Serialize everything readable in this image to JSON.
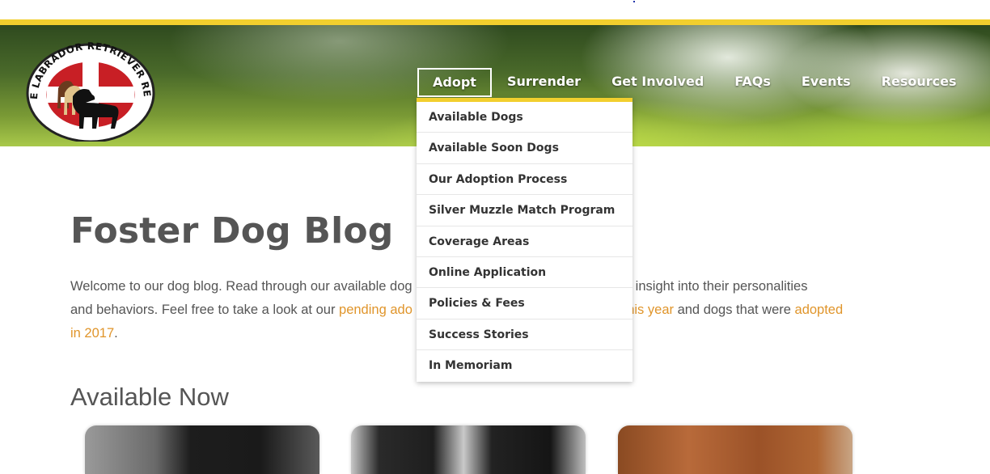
{
  "logo": {
    "text": "BROOKLINE LABRADOR RETRIEVER RESCUE, INC."
  },
  "nav": {
    "items": [
      {
        "label": "Adopt"
      },
      {
        "label": "Surrender"
      },
      {
        "label": "Get Involved"
      },
      {
        "label": "FAQs"
      },
      {
        "label": "Events"
      },
      {
        "label": "Resources"
      }
    ]
  },
  "adopt_menu": {
    "items": [
      {
        "label": "Available Dogs"
      },
      {
        "label": "Available Soon Dogs"
      },
      {
        "label": "Our Adoption Process"
      },
      {
        "label": "Silver Muzzle Match Program"
      },
      {
        "label": "Coverage Areas"
      },
      {
        "label": "Online Application"
      },
      {
        "label": "Policies & Fees"
      },
      {
        "label": "Success Stories"
      },
      {
        "label": "In Memoriam"
      }
    ]
  },
  "main": {
    "title": "Foster Dog Blog",
    "intro": {
      "t1": "Welcome to our dog blog. Read through our available dog",
      "t2": " a better insight into their personalities",
      "t3": "and behaviors. Feel free to take a look at our ",
      "link1": "pending ado",
      "link2": "d this year",
      "t4": " and dogs that were ",
      "link3": "adopted",
      "link3b": "in 2017",
      "t5": "."
    },
    "section_title": "Available Now"
  },
  "colors": {
    "accent_gold": "#f2cf2e",
    "link_orange": "#e0952b",
    "text_gray": "#555555"
  }
}
